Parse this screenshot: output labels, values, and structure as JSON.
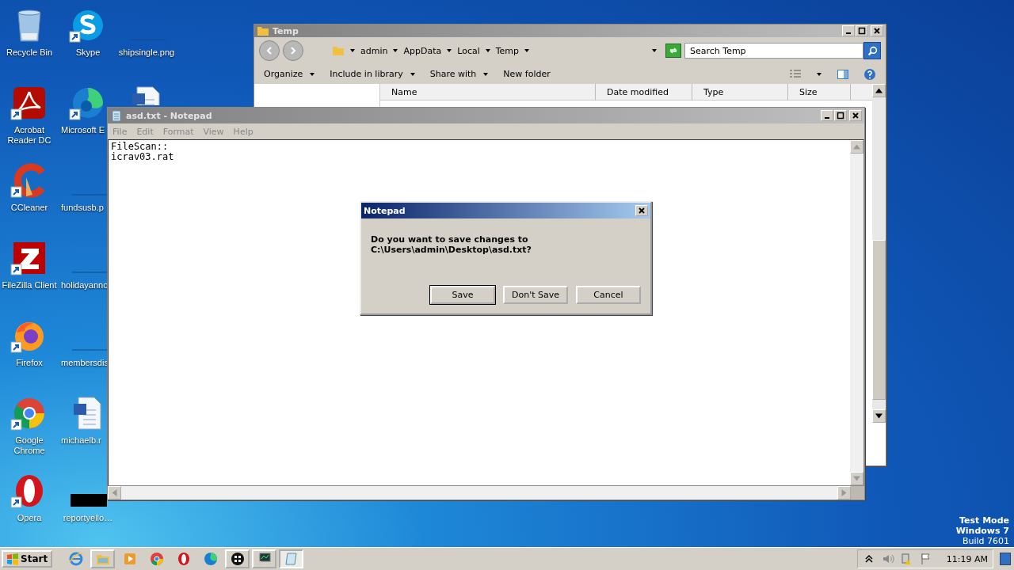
{
  "desktop_icons": [
    {
      "label": "Recycle Bin",
      "kind": "bin",
      "shortcut": false
    },
    {
      "label": "Acrobat\nReader DC",
      "kind": "acrobat",
      "shortcut": true
    },
    {
      "label": "CCleaner",
      "kind": "ccleaner",
      "shortcut": true
    },
    {
      "label": "FileZilla Client",
      "kind": "filezilla",
      "shortcut": true
    },
    {
      "label": "Firefox",
      "kind": "firefox",
      "shortcut": true
    },
    {
      "label": "Google\nChrome",
      "kind": "chrome",
      "shortcut": true
    },
    {
      "label": "Opera",
      "kind": "opera",
      "shortcut": true
    },
    {
      "label": "Skype",
      "kind": "skype",
      "shortcut": true
    },
    {
      "label": "Microsoft E",
      "kind": "edge",
      "shortcut": true
    },
    {
      "label": "fundsusb.p",
      "kind": "blank",
      "shortcut": false
    },
    {
      "label": "holidayanno",
      "kind": "blank",
      "shortcut": false
    },
    {
      "label": "membersdis",
      "kind": "blank",
      "shortcut": false
    },
    {
      "label": "michaelb.r",
      "kind": "word",
      "shortcut": false
    },
    {
      "label": "reportyello…",
      "kind": "black",
      "shortcut": false
    },
    {
      "label": "shipsingle.png",
      "kind": "blank",
      "shortcut": false
    },
    {
      "kind": "word"
    }
  ],
  "explorer": {
    "title": "Temp",
    "breadcrumbs": [
      "admin",
      "AppData",
      "Local",
      "Temp"
    ],
    "search": {
      "placeholder": "Search Temp"
    },
    "toolbar": [
      {
        "label": "Organize",
        "dropdown": true
      },
      {
        "label": "Include in library",
        "dropdown": true
      },
      {
        "label": "Share with",
        "dropdown": true
      },
      {
        "label": "New folder",
        "dropdown": false
      }
    ],
    "columns": [
      "Name",
      "Date modified",
      "Type",
      "Size"
    ]
  },
  "notepad": {
    "title": "asd.txt - Notepad",
    "menu": [
      "File",
      "Edit",
      "Format",
      "View",
      "Help"
    ],
    "lines": [
      "FileScan::",
      "icrav03.rat"
    ]
  },
  "dialog": {
    "title": "Notepad",
    "message": "Do you want to save changes to\nC:\\Users\\admin\\Desktop\\asd.txt?",
    "buttons": [
      {
        "label": "Save",
        "selected": true
      },
      {
        "label": "Don't Save",
        "selected": false
      },
      {
        "label": "Cancel",
        "selected": false
      }
    ]
  },
  "watermark_text": [
    "Test Mode",
    "Windows 7",
    "Build 7601"
  ],
  "taskbar": {
    "start": "Start",
    "apps": [
      {
        "kind": "ie",
        "framed": false,
        "selected": false
      },
      {
        "kind": "explorer",
        "framed": true,
        "selected": false
      },
      {
        "kind": "wmp",
        "framed": false,
        "selected": false
      },
      {
        "kind": "chrome",
        "framed": false,
        "selected": false
      },
      {
        "kind": "opera",
        "framed": false,
        "selected": false
      },
      {
        "kind": "edge",
        "framed": false,
        "selected": false
      },
      {
        "kind": "win",
        "framed": true,
        "selected": false
      },
      {
        "kind": "monitor",
        "framed": true,
        "selected": false
      },
      {
        "kind": "notepad",
        "framed": true,
        "selected": true
      }
    ],
    "time": "11:19 AM"
  }
}
